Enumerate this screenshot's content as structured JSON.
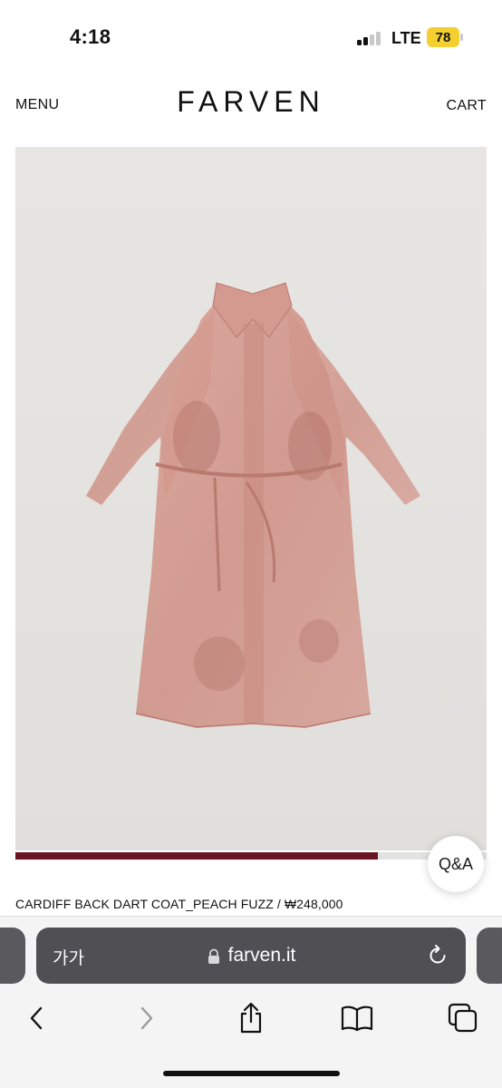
{
  "status_bar": {
    "time": "4:18",
    "network": "LTE",
    "battery": "78",
    "battery_color": "#f4cf2f"
  },
  "header": {
    "menu_label": "MENU",
    "brand": "FARVEN",
    "cart_label": "CART"
  },
  "product": {
    "image_icon": "coat-photo",
    "gallery_progress": 0.77,
    "progress_color": "#6b1422",
    "title": "CARDIFF BACK DART COAT_PEACH FUZZ / ₩248,000"
  },
  "qa_button": {
    "label": "Q&A"
  },
  "browser": {
    "text_size_label": "가가",
    "url": "farven.it",
    "icons": [
      "lock-icon",
      "reload-icon",
      "back-icon",
      "forward-icon",
      "share-icon",
      "bookmarks-icon",
      "tabs-icon"
    ]
  }
}
